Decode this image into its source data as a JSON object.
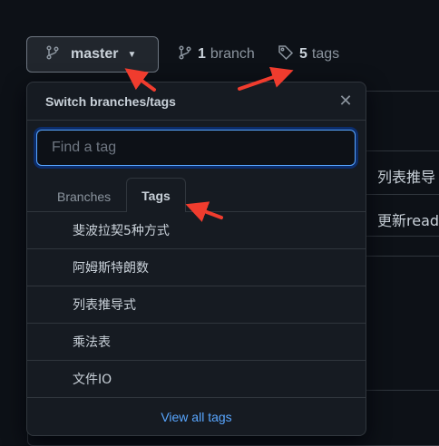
{
  "header": {
    "branch_button_label": "master",
    "branch_count": "1",
    "branch_word": "branch",
    "tag_count": "5",
    "tag_word": "tags"
  },
  "popover": {
    "title": "Switch branches/tags",
    "filter_placeholder": "Find a tag",
    "tabs": [
      {
        "label": "Branches",
        "active": false
      },
      {
        "label": "Tags",
        "active": true
      }
    ],
    "tags": [
      "斐波拉契5种方式",
      "阿姆斯特朗数",
      "列表推导式",
      "乘法表",
      "文件IO"
    ],
    "view_all_label": "View all tags"
  },
  "background": {
    "row1_text": "列表推导",
    "row2_text": "更新read"
  },
  "colors": {
    "accent": "#58a6ff",
    "annotation_arrow": "#f03c2e",
    "background": "#0d1117",
    "popover_bg": "#161b22"
  }
}
